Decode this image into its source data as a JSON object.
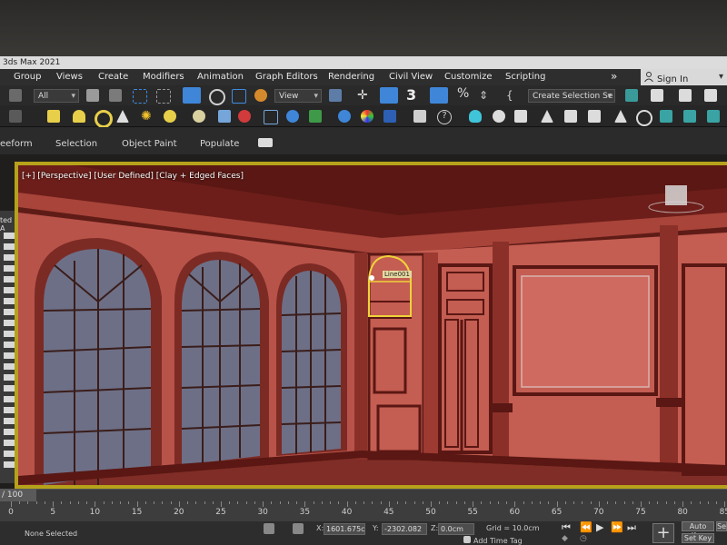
{
  "app": {
    "title": "3ds Max 2021"
  },
  "menu": {
    "items": [
      "Group",
      "Views",
      "Create",
      "Modifiers",
      "Animation",
      "Graph Editors",
      "Rendering",
      "Civil View",
      "Customize",
      "Scripting"
    ],
    "overflow": "»",
    "sign_in": "Sign In"
  },
  "toolbar": {
    "filter_value": "All",
    "coord_value": "View",
    "selection_set": "Create Selection Se",
    "snap_label": "3"
  },
  "ribbon": {
    "tabs": [
      "eeform",
      "Selection",
      "Object Paint",
      "Populate"
    ]
  },
  "viewport": {
    "label": "[+] [Perspective] [User Defined] [Clay + Edged Faces]",
    "selected_label": "Line001"
  },
  "left_panel": {
    "header": "ted A"
  },
  "timeline": {
    "slider_text": "/ 100",
    "ticks": [
      "0",
      "5",
      "10",
      "15",
      "20",
      "25",
      "30",
      "35",
      "40",
      "45",
      "50",
      "55",
      "60",
      "65",
      "70",
      "75",
      "80",
      "85"
    ]
  },
  "status": {
    "selection": "None Selected",
    "x_label": "X:",
    "x_value": "1601.675c",
    "y_label": "Y:",
    "y_value": "-2302.082",
    "z_label": "Z:",
    "z_value": "0.0cm",
    "grid": "Grid = 10.0cm",
    "add_time_tag": "Add Time Tag",
    "auto_key": "Auto Key",
    "set_key": "Set Key",
    "sel": "Se"
  },
  "colors": {
    "selection_yellow": "#f0d23a",
    "viewport_border": "#b6a21a",
    "accent_blue": "#2f7fd6"
  }
}
